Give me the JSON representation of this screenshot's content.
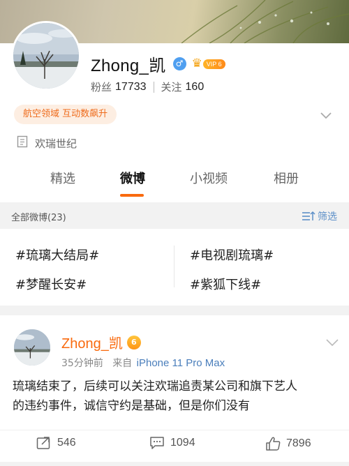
{
  "profile": {
    "name": "Zhong_凯",
    "gender_symbol": "♂",
    "vip_label": "VIP 6",
    "followers_label": "粉丝",
    "followers_count": "17733",
    "following_label": "关注",
    "following_count": "160",
    "badge": "航空领域 互动数飙升",
    "company": "欢瑞世纪"
  },
  "tabs": [
    {
      "label": "精选"
    },
    {
      "label": "微博"
    },
    {
      "label": "小视频"
    },
    {
      "label": "相册"
    }
  ],
  "active_tab": "微博",
  "filter_bar": {
    "title": "全部微博(23)",
    "filter_label": "筛选"
  },
  "topics": [
    "#琉璃大结局#",
    "#电视剧琉璃#",
    "#梦醒长安#",
    "#紫狐下线#"
  ],
  "post": {
    "author": "Zhong_凯",
    "vip_badge": "6",
    "time": "35分钟前",
    "source_prefix": "来自",
    "source": "iPhone 11 Pro Max",
    "text_line1": "琉璃结束了，后续可以关注欢瑞追责某公司和旗下艺人",
    "text_line2": "的违约事件，诚信守约是基础，但是你们没有",
    "reposts": "546",
    "comments": "1094",
    "likes": "7896"
  },
  "colors": {
    "accent": "#f96a0e",
    "link_blue": "#4a7ebb",
    "badge_bg": "#fdeee2"
  },
  "icons": [
    "gender-male-icon",
    "vip-crown-icon",
    "chevron-down-icon",
    "building-icon",
    "filter-icon",
    "repost-icon",
    "comment-icon",
    "like-icon"
  ]
}
